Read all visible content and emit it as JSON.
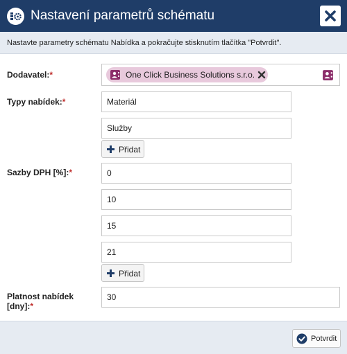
{
  "dialog": {
    "title": "Nastavení parametrů schématu",
    "title_icon": "schema-settings-icon",
    "close_icon": "close-icon",
    "instruction": "Nastavte parametry schématu Nabídka a pokračujte stisknutím tlačítka \"Potvrdit\"."
  },
  "supplier": {
    "label": "Dodavatel:",
    "required_mark": "*",
    "tag_label": "One Click Business Solutions s.r.o.",
    "tag_icon": "contact-card-icon",
    "picker_icon": "contact-card-icon"
  },
  "offer_types": {
    "label": "Typy nabídek:",
    "required_mark": "*",
    "values": [
      "Materiál",
      "Služby"
    ],
    "add_label": "Přidat"
  },
  "vat_rates": {
    "label": "Sazby DPH [%]:",
    "required_mark": "*",
    "values": [
      "0",
      "10",
      "15",
      "21"
    ],
    "add_label": "Přidat"
  },
  "validity": {
    "label_line1": "Platnost nabídek",
    "label_line2": "[dny]:",
    "required_mark": "*",
    "value": "30"
  },
  "footer": {
    "confirm_label": "Potvrdit",
    "confirm_icon": "check-circle-icon"
  },
  "colors": {
    "header_bg": "#1f3d68",
    "panel_bg": "#e6ebf2",
    "tag_bg": "#e8c9dc",
    "tag_icon": "#8c2e6a",
    "required": "#c0302e"
  }
}
